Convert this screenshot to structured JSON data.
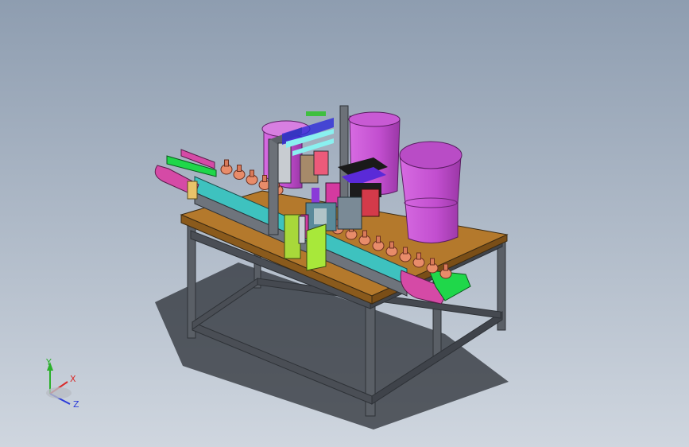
{
  "colors": {
    "background_top": "#93a2b4",
    "background_bottom": "#c9d1db",
    "table_top": "#b17a2e",
    "frame": "#4a4e55",
    "conveyor_belt": "#1fd94a",
    "conveyor_side": "#e04aa8",
    "bowl": "#c94fd6",
    "bottle": "#e88c6a",
    "rail": "#41c5c2"
  },
  "triad": {
    "x_label": "X",
    "y_label": "Y",
    "z_label": "Z",
    "x_color": "#d92b2b",
    "y_color": "#2bb02b",
    "z_color": "#2b3bd9"
  }
}
